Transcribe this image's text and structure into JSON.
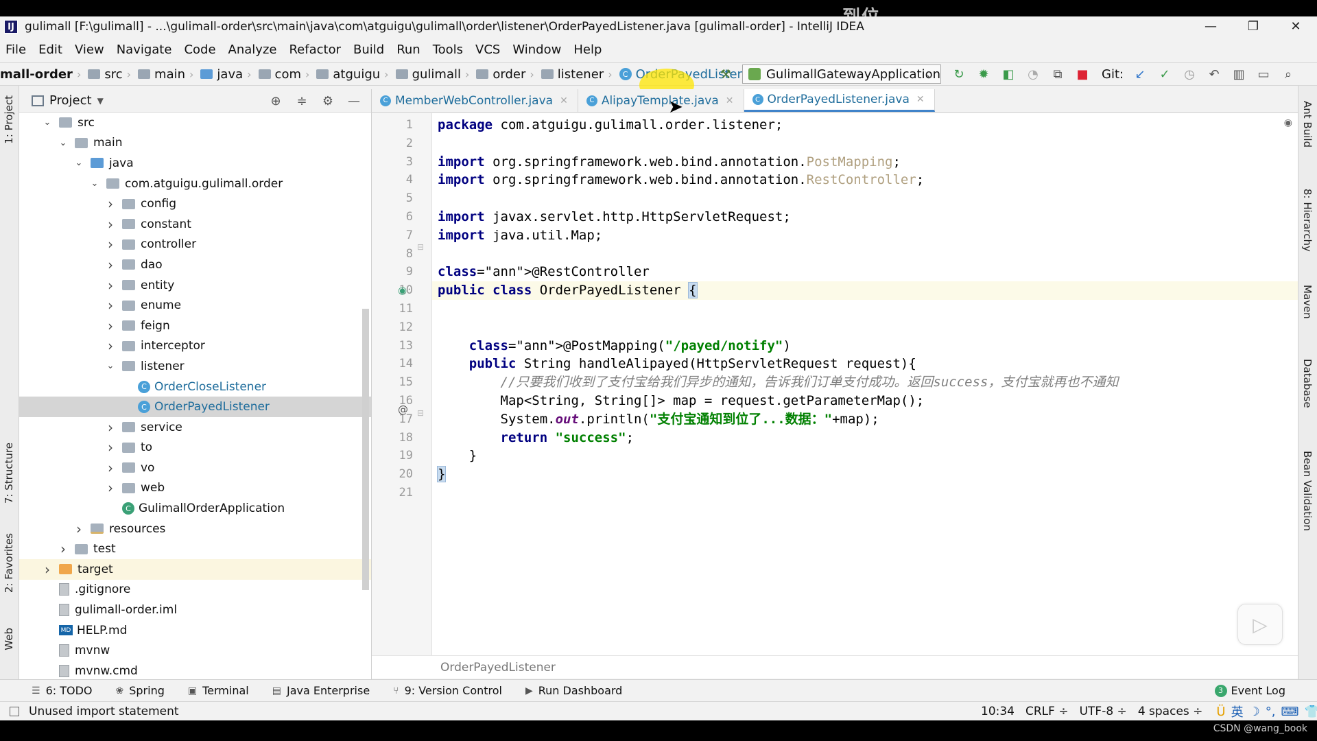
{
  "window": {
    "title": "gulimall [F:\\gulimall] - ...\\gulimall-order\\src\\main\\java\\com\\atguigu\\gulimall\\order\\listener\\OrderPayedListener.java [gulimall-order] - IntelliJ IDEA",
    "overlay_caption": "到位",
    "app_icon_glyph": "IJ"
  },
  "menu": [
    "File",
    "Edit",
    "View",
    "Navigate",
    "Code",
    "Analyze",
    "Refactor",
    "Build",
    "Run",
    "Tools",
    "VCS",
    "Window",
    "Help"
  ],
  "navbar": {
    "module": "mall-order",
    "crumbs": [
      "src",
      "main",
      "java",
      "com",
      "atguigu",
      "gulimall",
      "order",
      "listener"
    ],
    "class_crumb": "OrderPayedListener",
    "run_config": "GulimallGatewayApplication",
    "git_label": "Git:"
  },
  "left_strip": {
    "project": "1: Project",
    "structure": "7: Structure",
    "favorites": "2: Favorites",
    "web": "Web"
  },
  "right_strip": {
    "ant": "Ant Build",
    "hierarchy": "8: Hierarchy",
    "maven": "Maven",
    "database": "Database",
    "bean": "Bean Validation"
  },
  "project_panel": {
    "title": "Project",
    "tree": [
      {
        "label": "src",
        "indent": 1,
        "arrow": "down",
        "icon": "folder"
      },
      {
        "label": "main",
        "indent": 2,
        "arrow": "down",
        "icon": "folder"
      },
      {
        "label": "java",
        "indent": 3,
        "arrow": "down",
        "icon": "folder-blue"
      },
      {
        "label": "com.atguigu.gulimall.order",
        "indent": 4,
        "arrow": "down",
        "icon": "folder"
      },
      {
        "label": "config",
        "indent": 5,
        "arrow": "right",
        "icon": "folder"
      },
      {
        "label": "constant",
        "indent": 5,
        "arrow": "right",
        "icon": "folder"
      },
      {
        "label": "controller",
        "indent": 5,
        "arrow": "right",
        "icon": "folder"
      },
      {
        "label": "dao",
        "indent": 5,
        "arrow": "right",
        "icon": "folder"
      },
      {
        "label": "entity",
        "indent": 5,
        "arrow": "right",
        "icon": "folder"
      },
      {
        "label": "enume",
        "indent": 5,
        "arrow": "right",
        "icon": "folder"
      },
      {
        "label": "feign",
        "indent": 5,
        "arrow": "right",
        "icon": "folder"
      },
      {
        "label": "interceptor",
        "indent": 5,
        "arrow": "right",
        "icon": "folder"
      },
      {
        "label": "listener",
        "indent": 5,
        "arrow": "down",
        "icon": "folder"
      },
      {
        "label": "OrderCloseListener",
        "indent": 6,
        "arrow": "",
        "icon": "class"
      },
      {
        "label": "OrderPayedListener",
        "indent": 6,
        "arrow": "",
        "icon": "class",
        "selected": true
      },
      {
        "label": "service",
        "indent": 5,
        "arrow": "right",
        "icon": "folder"
      },
      {
        "label": "to",
        "indent": 5,
        "arrow": "right",
        "icon": "folder"
      },
      {
        "label": "vo",
        "indent": 5,
        "arrow": "right",
        "icon": "folder"
      },
      {
        "label": "web",
        "indent": 5,
        "arrow": "right",
        "icon": "folder"
      },
      {
        "label": "GulimallOrderApplication",
        "indent": 5,
        "arrow": "",
        "icon": "app"
      },
      {
        "label": "resources",
        "indent": 3,
        "arrow": "right",
        "icon": "folder-res"
      },
      {
        "label": "test",
        "indent": 2,
        "arrow": "right",
        "icon": "folder"
      },
      {
        "label": "target",
        "indent": 1,
        "arrow": "right",
        "icon": "folder-orange",
        "target": true
      },
      {
        "label": ".gitignore",
        "indent": 1,
        "arrow": "",
        "icon": "file"
      },
      {
        "label": "gulimall-order.iml",
        "indent": 1,
        "arrow": "",
        "icon": "file"
      },
      {
        "label": "HELP.md",
        "indent": 1,
        "arrow": "",
        "icon": "md"
      },
      {
        "label": "mvnw",
        "indent": 1,
        "arrow": "",
        "icon": "file"
      },
      {
        "label": "mvnw.cmd",
        "indent": 1,
        "arrow": "",
        "icon": "file"
      }
    ]
  },
  "editor_tabs": [
    {
      "label": "MemberWebController.java",
      "active": false
    },
    {
      "label": "AlipayTemplate.java",
      "active": false
    },
    {
      "label": "OrderPayedListener.java",
      "active": true
    }
  ],
  "code_lines": [
    "package com.atguigu.gulimall.order.listener;",
    "",
    "import org.springframework.web.bind.annotation.PostMapping;",
    "import org.springframework.web.bind.annotation.RestController;",
    "",
    "import javax.servlet.http.HttpServletRequest;",
    "import java.util.Map;",
    "",
    "@RestController",
    "public class OrderPayedListener {",
    "",
    "",
    "    @PostMapping(\"/payed/notify\")",
    "    public String handleAlipayed(HttpServletRequest request){",
    "        //只要我们收到了支付宝给我们异步的通知，告诉我们订单支付成功。返回success，支付宝就再也不通知",
    "        Map<String, String[]> map = request.getParameterMap();",
    "        System.out.println(\"支付宝通知到位了...数据：\"+map);",
    "        return \"success\";",
    "    }",
    "}",
    ""
  ],
  "line_numbers": [
    "1",
    "2",
    "3",
    "4",
    "5",
    "6",
    "7",
    "8",
    "9",
    "10",
    "11",
    "12",
    "13",
    "14",
    "15",
    "16",
    "17",
    "18",
    "19",
    "20",
    "21"
  ],
  "editor_footer": "OrderPayedListener",
  "bottom_tools": [
    {
      "icon": "☰",
      "label": "6: TODO"
    },
    {
      "icon": "❀",
      "label": "Spring"
    },
    {
      "icon": "▣",
      "label": "Terminal"
    },
    {
      "icon": "▤",
      "label": "Java Enterprise"
    },
    {
      "icon": "⑂",
      "label": "9: Version Control"
    },
    {
      "icon": "▶",
      "label": "Run Dashboard"
    }
  ],
  "event_log": {
    "badge": "3",
    "label": "Event Log"
  },
  "status": {
    "message": "Unused import statement",
    "position": "10:34",
    "line_sep": "CRLF ÷",
    "encoding": "UTF-8 ÷",
    "indent": "4 spaces ÷",
    "ime": [
      "英",
      "☽",
      "°,",
      "⌨",
      "👕",
      "🔧"
    ]
  },
  "watermark": "CSDN @wang_book",
  "colors": {
    "accent": "#4083c9",
    "keyword": "#000080",
    "string": "#008000",
    "annotation": "#808000",
    "comment": "#808080"
  }
}
